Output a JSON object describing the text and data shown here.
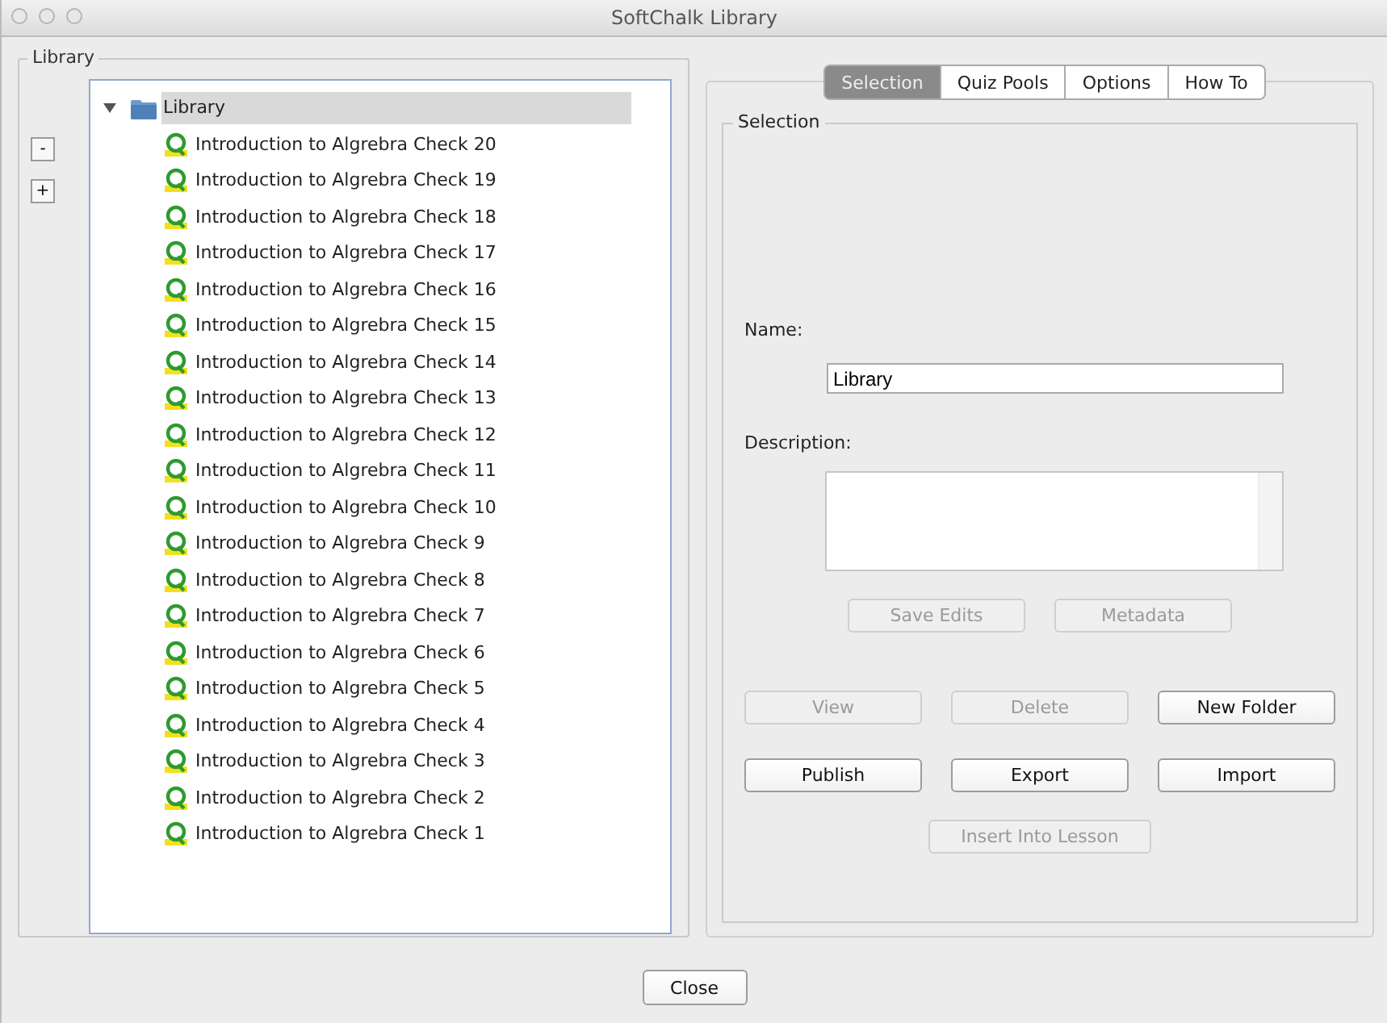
{
  "window": {
    "title": "SoftChalk Library"
  },
  "library_panel": {
    "title": "Library",
    "collapse_button": "-",
    "expand_button": "+",
    "tree": {
      "label": "Library",
      "expanded": true,
      "selected": true,
      "children": [
        {
          "label": "Introduction to Algrebra Check 20"
        },
        {
          "label": "Introduction to Algrebra Check 19"
        },
        {
          "label": "Introduction to Algrebra Check 18"
        },
        {
          "label": "Introduction to Algrebra Check 17"
        },
        {
          "label": "Introduction to Algrebra Check 16"
        },
        {
          "label": "Introduction to Algrebra Check 15"
        },
        {
          "label": "Introduction to Algrebra Check 14"
        },
        {
          "label": "Introduction to Algrebra Check 13"
        },
        {
          "label": "Introduction to Algrebra Check 12"
        },
        {
          "label": "Introduction to Algrebra Check 11"
        },
        {
          "label": "Introduction to Algrebra Check 10"
        },
        {
          "label": "Introduction to Algrebra Check 9"
        },
        {
          "label": "Introduction to Algrebra Check 8"
        },
        {
          "label": "Introduction to Algrebra Check 7"
        },
        {
          "label": "Introduction to Algrebra Check 6"
        },
        {
          "label": "Introduction to Algrebra Check 5"
        },
        {
          "label": "Introduction to Algrebra Check 4"
        },
        {
          "label": "Introduction to Algrebra Check 3"
        },
        {
          "label": "Introduction to Algrebra Check 2"
        },
        {
          "label": "Introduction to Algrebra Check 1"
        }
      ]
    }
  },
  "tabs": [
    {
      "label": "Selection",
      "selected": true
    },
    {
      "label": "Quiz Pools",
      "selected": false
    },
    {
      "label": "Options",
      "selected": false
    },
    {
      "label": "How To",
      "selected": false
    }
  ],
  "selection": {
    "title": "Selection",
    "name_label": "Name:",
    "name_value": "Library",
    "description_label": "Description:",
    "edit_buttons": [
      {
        "label": "Save Edits",
        "disabled": true
      },
      {
        "label": "Metadata",
        "disabled": true
      }
    ],
    "action_buttons": [
      {
        "label": "View",
        "disabled": true
      },
      {
        "label": "Delete",
        "disabled": true
      },
      {
        "label": "New Folder",
        "disabled": false
      },
      {
        "label": "Publish",
        "disabled": false
      },
      {
        "label": "Export",
        "disabled": false
      },
      {
        "label": "Import",
        "disabled": false
      }
    ],
    "insert_button": {
      "label": "Insert Into Lesson",
      "disabled": true
    }
  },
  "close_button": "Close"
}
